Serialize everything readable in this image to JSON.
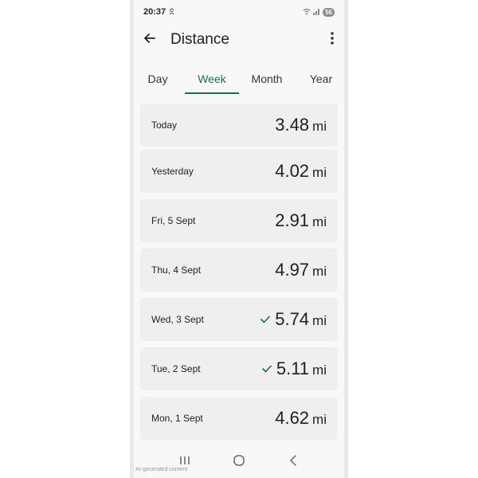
{
  "status_bar": {
    "time": "20:37",
    "battery": "56"
  },
  "app_bar": {
    "title": "Distance"
  },
  "tabs": [
    {
      "label": "Day",
      "active": false
    },
    {
      "label": "Week",
      "active": true
    },
    {
      "label": "Month",
      "active": false
    },
    {
      "label": "Year",
      "active": false
    }
  ],
  "rows": [
    {
      "label": "Today",
      "value": "3.48",
      "unit": "mi",
      "checked": false
    },
    {
      "label": "Yesterday",
      "value": "4.02",
      "unit": "mi",
      "checked": false
    },
    {
      "label": "Fri, 5 Sept",
      "value": "2.91",
      "unit": "mi",
      "checked": false
    },
    {
      "label": "Thu, 4 Sept",
      "value": "4.97",
      "unit": "mi",
      "checked": false
    },
    {
      "label": "Wed, 3 Sept",
      "value": "5.74",
      "unit": "mi",
      "checked": true
    },
    {
      "label": "Tue, 2 Sept",
      "value": "5.11",
      "unit": "mi",
      "checked": true
    },
    {
      "label": "Mon, 1 Sept",
      "value": "4.62",
      "unit": "mi",
      "checked": false
    }
  ],
  "footer_note": "AI-generated content",
  "colors": {
    "accent": "#1b6b5a",
    "card": "#efefef",
    "background": "#f8f8f8"
  },
  "icons": {
    "back": "arrow-left-icon",
    "more": "more-vertical-icon",
    "check": "check-icon",
    "recents": "recents-icon",
    "home": "home-icon",
    "nav_back": "nav-back-icon"
  }
}
